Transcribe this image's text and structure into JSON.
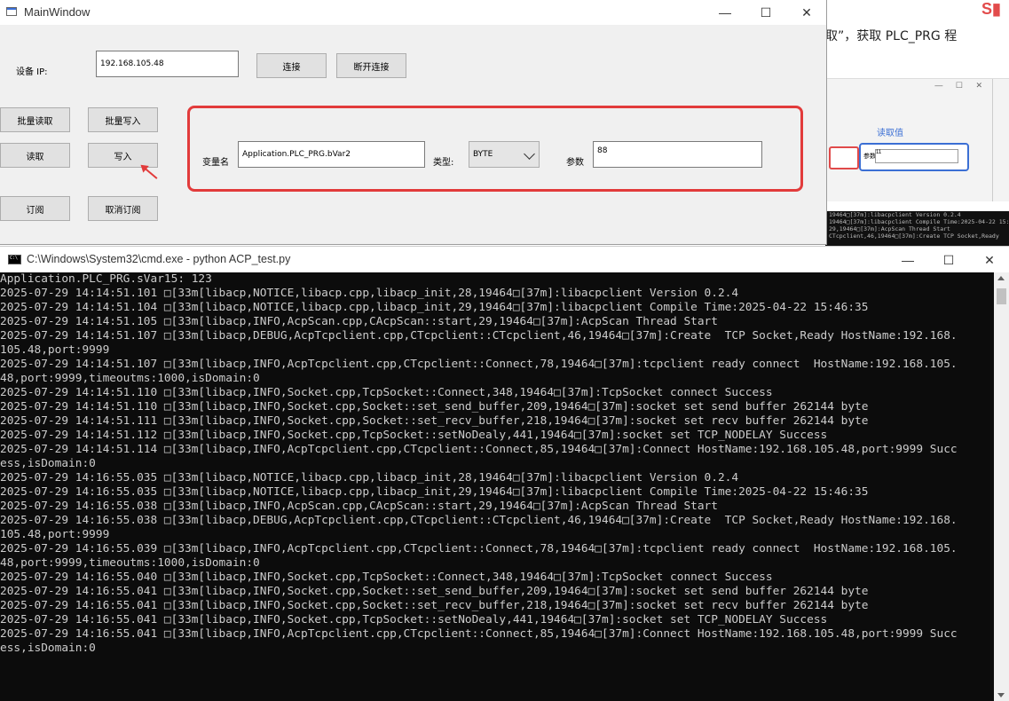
{
  "background": {
    "doc_text": "取”，获取 PLC_PRG 程",
    "thumb_read_label": "读取值",
    "thumb_param_label": "参数",
    "thumb_param_value": "11",
    "mini_console": [
      "19464□[37m]:libacpclient Version 0.2.4",
      "19464□[37m]:libacpclient Compile Time:2025-04-22 15:",
      "29,19464□[37m]:AcpScan Thread Start",
      "CTcpclient,46,19464□[37m]:Create TCP Socket,Ready"
    ]
  },
  "main_window": {
    "title": "MainWindow",
    "device_ip_label": "设备 IP:",
    "device_ip_value": "192.168.105.48",
    "connect_button": "连接",
    "disconnect_button": "断开连接",
    "batch_read_button": "批量读取",
    "batch_write_button": "批量写入",
    "read_button": "读取",
    "write_button": "写入",
    "subscribe_button": "订阅",
    "unsubscribe_button": "取消订阅",
    "var_name_label": "变量名",
    "var_name_value": "Application.PLC_PRG.bVar2",
    "type_label": "类型:",
    "type_value": "BYTE",
    "param_label": "参数",
    "param_value": "88",
    "minimize_icon": "—",
    "maximize_icon": "☐",
    "close_icon": "✕"
  },
  "console_window": {
    "title": "C:\\Windows\\System32\\cmd.exe - python  ACP_test.py",
    "minimize_icon": "—",
    "maximize_icon": "☐",
    "close_icon": "✕",
    "lines": [
      "Application.PLC_PRG.sVar15: 123",
      "2025-07-29 14:14:51.101 □[33m[libacp,NOTICE,libacp.cpp,libacp_init,28,19464□[37m]:libacpclient Version 0.2.4",
      "2025-07-29 14:14:51.104 □[33m[libacp,NOTICE,libacp.cpp,libacp_init,29,19464□[37m]:libacpclient Compile Time:2025-04-22 15:46:35",
      "2025-07-29 14:14:51.105 □[33m[libacp,INFO,AcpScan.cpp,CAcpScan::start,29,19464□[37m]:AcpScan Thread Start",
      "2025-07-29 14:14:51.107 □[33m[libacp,DEBUG,AcpTcpclient.cpp,CTcpclient::CTcpclient,46,19464□[37m]:Create  TCP Socket,Ready HostName:192.168.",
      "105.48,port:9999",
      "2025-07-29 14:14:51.107 □[33m[libacp,INFO,AcpTcpclient.cpp,CTcpclient::Connect,78,19464□[37m]:tcpclient ready connect  HostName:192.168.105.",
      "48,port:9999,timeoutms:1000,isDomain:0",
      "2025-07-29 14:14:51.110 □[33m[libacp,INFO,Socket.cpp,TcpSocket::Connect,348,19464□[37m]:TcpSocket connect Success",
      "2025-07-29 14:14:51.110 □[33m[libacp,INFO,Socket.cpp,Socket::set_send_buffer,209,19464□[37m]:socket set send buffer 262144 byte",
      "2025-07-29 14:14:51.111 □[33m[libacp,INFO,Socket.cpp,Socket::set_recv_buffer,218,19464□[37m]:socket set recv buffer 262144 byte",
      "2025-07-29 14:14:51.112 □[33m[libacp,INFO,Socket.cpp,TcpSocket::setNoDealy,441,19464□[37m]:socket set TCP_NODELAY Success",
      "2025-07-29 14:14:51.114 □[33m[libacp,INFO,AcpTcpclient.cpp,CTcpclient::Connect,85,19464□[37m]:Connect HostName:192.168.105.48,port:9999 Succ",
      "ess,isDomain:0",
      "2025-07-29 14:16:55.035 □[33m[libacp,NOTICE,libacp.cpp,libacp_init,28,19464□[37m]:libacpclient Version 0.2.4",
      "2025-07-29 14:16:55.035 □[33m[libacp,NOTICE,libacp.cpp,libacp_init,29,19464□[37m]:libacpclient Compile Time:2025-04-22 15:46:35",
      "2025-07-29 14:16:55.038 □[33m[libacp,INFO,AcpScan.cpp,CAcpScan::start,29,19464□[37m]:AcpScan Thread Start",
      "2025-07-29 14:16:55.038 □[33m[libacp,DEBUG,AcpTcpclient.cpp,CTcpclient::CTcpclient,46,19464□[37m]:Create  TCP Socket,Ready HostName:192.168.",
      "105.48,port:9999",
      "2025-07-29 14:16:55.039 □[33m[libacp,INFO,AcpTcpclient.cpp,CTcpclient::Connect,78,19464□[37m]:tcpclient ready connect  HostName:192.168.105.",
      "48,port:9999,timeoutms:1000,isDomain:0",
      "2025-07-29 14:16:55.040 □[33m[libacp,INFO,Socket.cpp,TcpSocket::Connect,348,19464□[37m]:TcpSocket connect Success",
      "2025-07-29 14:16:55.041 □[33m[libacp,INFO,Socket.cpp,Socket::set_send_buffer,209,19464□[37m]:socket set send buffer 262144 byte",
      "2025-07-29 14:16:55.041 □[33m[libacp,INFO,Socket.cpp,Socket::set_recv_buffer,218,19464□[37m]:socket set recv buffer 262144 byte",
      "2025-07-29 14:16:55.041 □[33m[libacp,INFO,Socket.cpp,TcpSocket::setNoDealy,441,19464□[37m]:socket set TCP_NODELAY Success",
      "2025-07-29 14:16:55.041 □[33m[libacp,INFO,AcpTcpclient.cpp,CTcpclient::Connect,85,19464□[37m]:Connect HostName:192.168.105.48,port:9999 Succ",
      "ess,isDomain:0"
    ]
  },
  "colors": {
    "highlight_red": "#e23b3b",
    "console_bg": "#0c0c0c",
    "console_text": "#cccccc"
  }
}
